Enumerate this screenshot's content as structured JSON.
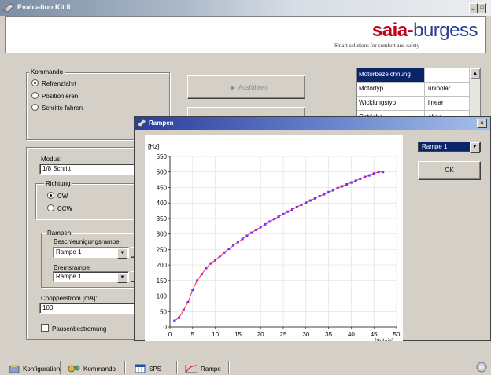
{
  "window": {
    "title": "Evaluation Kit II"
  },
  "header": {
    "logo_saia": "saia",
    "logo_dash": "-",
    "logo_burgess": "burgess",
    "tagline": "Smart solutions for comfort and safety"
  },
  "kommando": {
    "label": "Kommando",
    "options": [
      {
        "label": "Refrenzfahrt",
        "selected": true
      },
      {
        "label": "Positionieren",
        "selected": false
      },
      {
        "label": "Schritte fahren",
        "selected": false
      }
    ],
    "execute_label": "Ausführen"
  },
  "properties": {
    "rows": [
      {
        "key": "Motorbezeichnung",
        "value": ""
      },
      {
        "key": "Motortyp",
        "value": "unipolar"
      },
      {
        "key": "Wicklungstyp",
        "value": "linear"
      },
      {
        "key": "Getriebe",
        "value": "ohne"
      }
    ]
  },
  "settings": {
    "modus_label": "Modus:",
    "modus_value": "1/8 Schritt",
    "richtung_label": "Richtung",
    "richtung_options": [
      {
        "label": "CW",
        "selected": true
      },
      {
        "label": "CCW",
        "selected": false
      }
    ],
    "rampen_label": "Rampen",
    "beschleunigung_label": "Beschleunigungsrampe:",
    "beschleunigung_value": "Rampe 1",
    "brems_label": "Bremsrampe:",
    "brems_value": "Rampe 1",
    "chopper_label": "Chopperstrom [mA]:",
    "chopper_value": "100",
    "pause_label": "Pausenbestromung"
  },
  "dialog": {
    "title": "Rampen",
    "select_value": "Rampe 1",
    "ok_label": "OK"
  },
  "chart_data": {
    "type": "line",
    "ylabel": "[Hz]",
    "xlabel": "[Schritt]",
    "xlim": [
      0,
      50
    ],
    "ylim": [
      0,
      550
    ],
    "x_ticks": [
      0,
      5,
      10,
      15,
      20,
      25,
      30,
      35,
      40,
      45,
      50
    ],
    "y_ticks": [
      0,
      50,
      100,
      150,
      200,
      250,
      300,
      350,
      400,
      450,
      500,
      550
    ],
    "grid": true,
    "series": [
      {
        "color": "#7a2cff",
        "marker_color": "#ff3030",
        "x": [
          1,
          2,
          3,
          4,
          5,
          6,
          7,
          8,
          9,
          10,
          11,
          12,
          13,
          14,
          15,
          16,
          17,
          18,
          19,
          20,
          21,
          22,
          23,
          24,
          25,
          26,
          27,
          28,
          29,
          30,
          31,
          32,
          33,
          34,
          35,
          36,
          37,
          38,
          39,
          40,
          41,
          42,
          43,
          44,
          45,
          46,
          47
        ],
        "y": [
          20,
          30,
          55,
          80,
          120,
          150,
          170,
          190,
          205,
          215,
          228,
          240,
          252,
          263,
          274,
          284,
          294,
          304,
          313,
          322,
          331,
          340,
          348,
          356,
          364,
          372,
          379,
          387,
          394,
          401,
          408,
          415,
          422,
          428,
          435,
          441,
          448,
          454,
          460,
          466,
          472,
          478,
          484,
          489,
          495,
          500,
          500
        ]
      }
    ]
  },
  "taskbar": {
    "tabs": [
      {
        "label": "Konfiguration"
      },
      {
        "label": "Kommando"
      },
      {
        "label": "SPS"
      },
      {
        "label": "Rampe"
      }
    ]
  }
}
